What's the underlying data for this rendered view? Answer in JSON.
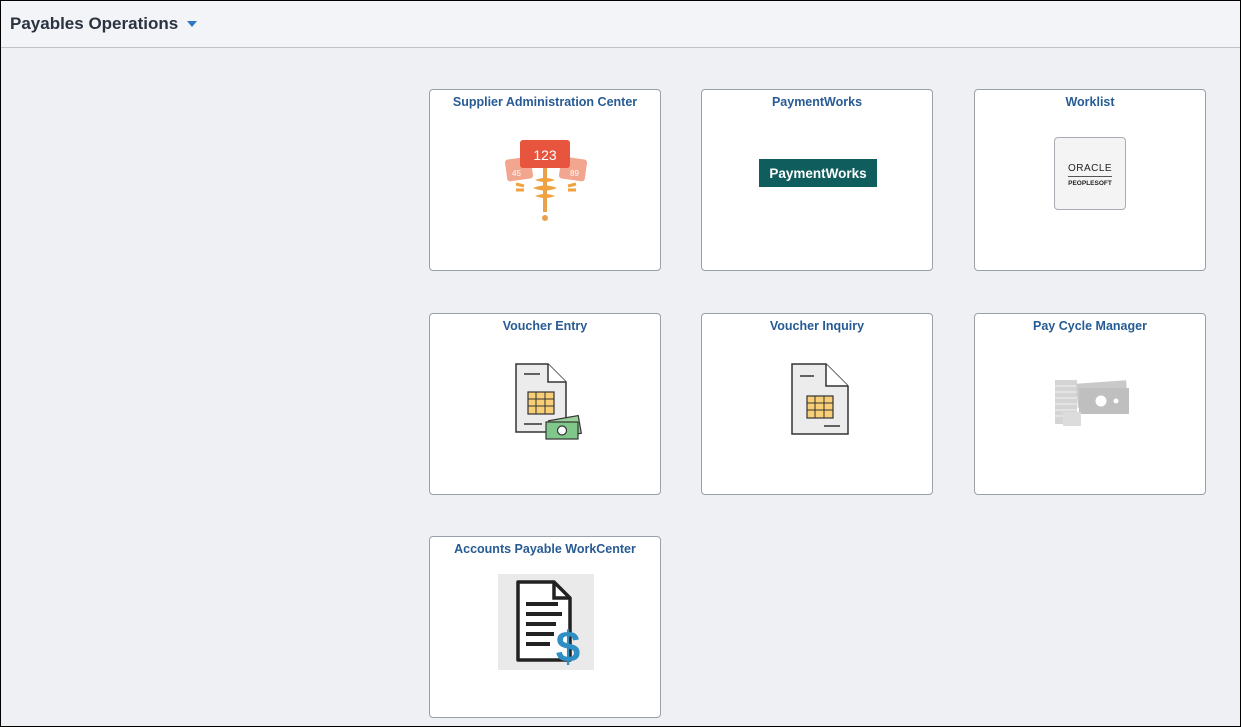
{
  "header": {
    "title": "Payables Operations",
    "menu_icon": "chevron-down-icon"
  },
  "tiles": [
    {
      "title": "Supplier Administration Center",
      "icon": "supplier-number-tags-icon",
      "badge_text": "123"
    },
    {
      "title": "PaymentWorks",
      "icon": "paymentworks-logo",
      "logo_text": "PaymentWorks"
    },
    {
      "title": "Worklist",
      "icon": "oracle-peoplesoft-logo",
      "logo_line1": "ORACLE",
      "logo_line2": "PEOPLESOFT"
    },
    {
      "title": "Voucher Entry",
      "icon": "voucher-entry-icon"
    },
    {
      "title": "Voucher Inquiry",
      "icon": "voucher-inquiry-icon"
    },
    {
      "title": "Pay Cycle Manager",
      "icon": "pay-cycle-money-icon"
    },
    {
      "title": "Accounts Payable WorkCenter",
      "icon": "accounts-payable-document-icon"
    }
  ],
  "colors": {
    "tile_title": "#275b94",
    "background": "#eff0f4",
    "caret": "#2c76c4",
    "paymentworks": "#0f5d5c"
  }
}
